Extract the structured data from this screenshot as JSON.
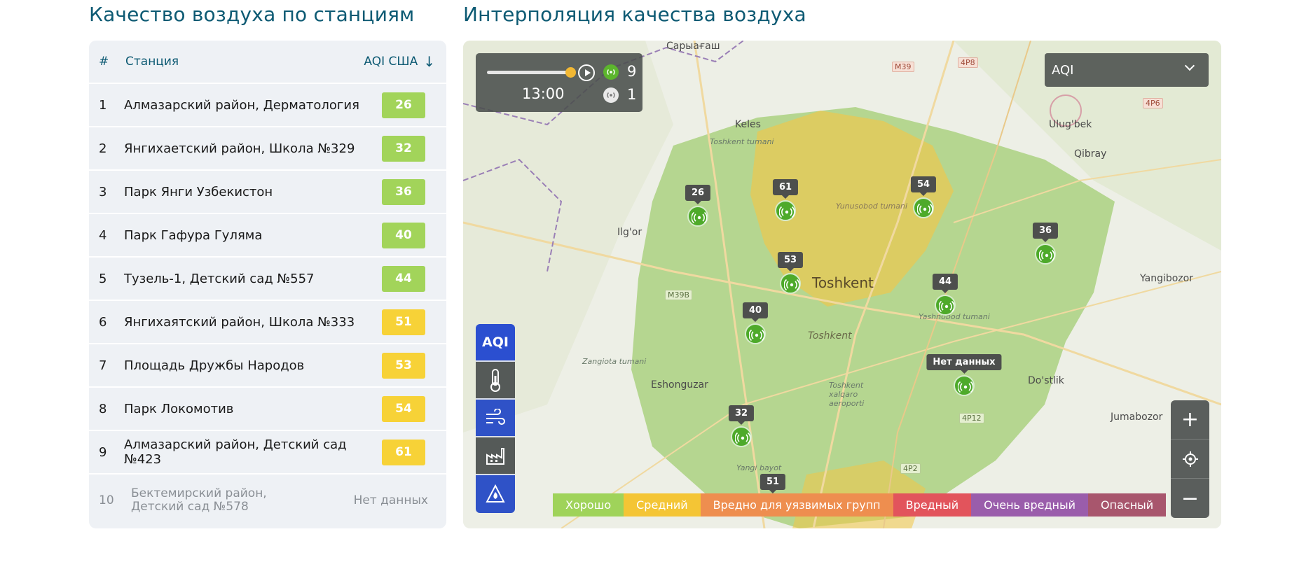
{
  "titles": {
    "stations": "Качество воздуха по станциям",
    "interpolation": "Интерполяция качества воздуха"
  },
  "table": {
    "header": {
      "num": "#",
      "station": "Станция",
      "aqi": "AQI США"
    },
    "rows": [
      {
        "num": "1",
        "name": "Алмазарский район, Дерматология",
        "aqi": "26",
        "color": "#a2d45a"
      },
      {
        "num": "2",
        "name": "Янгихаетский район, Школа №329",
        "aqi": "32",
        "color": "#a2d45a"
      },
      {
        "num": "3",
        "name": "Парк Янги Узбекистон",
        "aqi": "36",
        "color": "#a2d45a"
      },
      {
        "num": "4",
        "name": "Парк Гафура Гуляма",
        "aqi": "40",
        "color": "#a2d45a"
      },
      {
        "num": "5",
        "name": "Тузель-1, Детский сад №557",
        "aqi": "44",
        "color": "#a2d45a"
      },
      {
        "num": "6",
        "name": "Янгихаятский район, Школа №333",
        "aqi": "51",
        "color": "#f7d237"
      },
      {
        "num": "7",
        "name": "Площадь Дружбы Народов",
        "aqi": "53",
        "color": "#f7d237"
      },
      {
        "num": "8",
        "name": "Парк Локомотив",
        "aqi": "54",
        "color": "#f7d237"
      },
      {
        "num": "9",
        "name": "Алмазарский район, Детский сад №423",
        "aqi": "61",
        "color": "#f7d237"
      }
    ],
    "nodata_row": {
      "num": "10",
      "name": "Бектемирский район, Детский сад №578",
      "value": "Нет данных"
    }
  },
  "map": {
    "time": "13:00",
    "active_count": "9",
    "inactive_count": "1",
    "selector": "AQI",
    "layer_aqi_label": "AQI",
    "legend": [
      {
        "label": "Хорошо",
        "color": "#9fd35a"
      },
      {
        "label": "Средний",
        "color": "#f4c535"
      },
      {
        "label": "Вредно для уязвимых групп",
        "color": "#ee8e4f"
      },
      {
        "label": "Вредный",
        "color": "#e2545c"
      },
      {
        "label": "Очень вредный",
        "color": "#9a5dab"
      },
      {
        "label": "Опасный",
        "color": "#a8566d"
      }
    ],
    "markers": [
      "26",
      "61",
      "54",
      "36",
      "53",
      "44",
      "40",
      "Нет данных",
      "32",
      "51"
    ],
    "places": {
      "saryagash": "Сарыағаш",
      "keles": "Keles",
      "keles_district": "Toshkent tumani",
      "ulugbek": "Ulug'bek",
      "qibray": "Qibray",
      "ilgor": "Ilg'or",
      "yunusobod": "Yunusobod tumani",
      "toshkent_big": "Toshkent",
      "toshkent_small": "Toshkent",
      "yashnobod": "Yashnobod tumani",
      "yangibozor": "Yangibozor",
      "zangiota": "Zangiota tumani",
      "eshonguzar": "Eshonguzar",
      "airport": "Toshkent xalqaro aeroporti",
      "dostlik": "Do'stlik",
      "jumabozor": "Jumabozor",
      "yangi_bayot": "Yangi bayot"
    },
    "roads": [
      "M39",
      "4P8",
      "4P6",
      "M39B",
      "4P12",
      "4P2"
    ]
  }
}
